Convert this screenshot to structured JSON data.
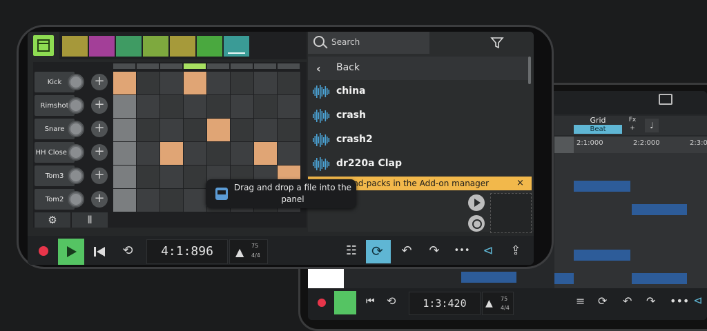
{
  "background_phone": {
    "grid_label": "Grid",
    "beat_label": "Beat",
    "fx_label": "Fx",
    "fx_plus": "+",
    "ruler": [
      "2:1:000",
      "2:2:000",
      "2:3:0"
    ],
    "time": "1:3:420",
    "tempo": "75",
    "signature": "4/4"
  },
  "pattern_colors": [
    "#a6983a",
    "#a33f98",
    "#3f9b63",
    "#7ea93e",
    "#a69a3a",
    "#4aa83f",
    "#3a9b96"
  ],
  "instruments": [
    {
      "name": "Kick"
    },
    {
      "name": "Rimshot"
    },
    {
      "name": "Snare"
    },
    {
      "name": "HH Close d"
    },
    {
      "name": "Tom3"
    },
    {
      "name": "Tom2"
    }
  ],
  "steps": [
    [
      1,
      0,
      0,
      1,
      0,
      0,
      0,
      0
    ],
    [
      0,
      0,
      0,
      0,
      0,
      0,
      0,
      0
    ],
    [
      0,
      0,
      0,
      0,
      1,
      0,
      0,
      0
    ],
    [
      0,
      0,
      1,
      0,
      0,
      0,
      1,
      0
    ],
    [
      0,
      0,
      0,
      0,
      0,
      0,
      0,
      1
    ],
    [
      0,
      0,
      0,
      0,
      0,
      0,
      0,
      0
    ]
  ],
  "browser": {
    "search_placeholder": "Search",
    "back_label": "Back",
    "items": [
      "china",
      "crash",
      "crash2",
      "dr220a Clap"
    ],
    "notice": "sound-packs in the Add-on manager",
    "notice_close": "×"
  },
  "tooltip": "Drag and drop a file into the panel",
  "transport": {
    "time": "4:1:896",
    "tempo": "75",
    "signature": "4/4"
  },
  "colors": {
    "accent_green": "#55c463",
    "accent_blue": "#5fb6d4",
    "step_on": "#e0a575",
    "notice": "#f2b84b",
    "record": "#e8354a"
  }
}
